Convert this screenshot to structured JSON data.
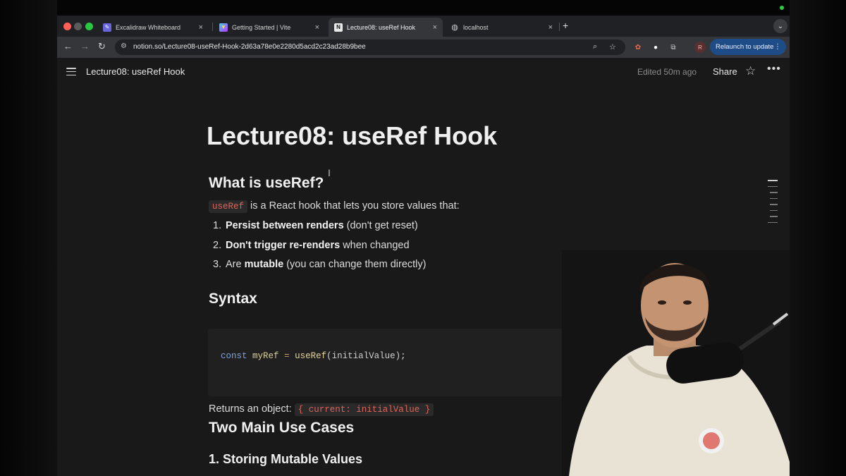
{
  "browser": {
    "tabs": [
      {
        "label": "Excalidraw Whiteboard",
        "icon": "excalidraw-icon",
        "active": false
      },
      {
        "label": "Getting Started | Vite",
        "icon": "vite-icon",
        "active": false
      },
      {
        "label": "Lecture08: useRef Hook",
        "icon": "notion-icon",
        "active": true
      },
      {
        "label": "localhost",
        "icon": "globe-icon",
        "active": false
      }
    ],
    "url": "notion.so/Lecture08-useRef-Hook-2d63a78e0e2280d5acd2c23ad28b9bee",
    "profile_initial": "R",
    "relaunch_label": "Relaunch to update"
  },
  "header": {
    "page_name": "Lecture08: useRef Hook",
    "edited": "Edited 50m ago",
    "share_label": "Share"
  },
  "page": {
    "title": "Lecture08: useRef Hook",
    "what_heading": "What is useRef?",
    "intro_code": "useRef",
    "intro_text": " is a React hook that lets you store values that:",
    "list": [
      {
        "num": "1.",
        "bold": "Persist between renders",
        "rest": " (don't get reset)",
        "pre": ""
      },
      {
        "num": "2.",
        "bold": "Don't trigger re-renders",
        "rest": " when changed",
        "pre": ""
      },
      {
        "num": "3.",
        "pre": "Are ",
        "bold": "mutable",
        "rest": " (you can change them directly)"
      }
    ],
    "syntax_heading": "Syntax",
    "code": {
      "kw": "const",
      "var": "myRef",
      "op": "=",
      "fn": "useRef",
      "args": "(initialValue);"
    },
    "returns_text": "Returns an object: ",
    "returns_code": "{ current: initialValue }",
    "use_cases_heading": "Two Main Use Cases",
    "sub_heading": "1. Storing Mutable Values"
  },
  "colors": {
    "accent": "#1e4c87",
    "inline_code": "#e0645a",
    "page_bg": "#191919"
  }
}
